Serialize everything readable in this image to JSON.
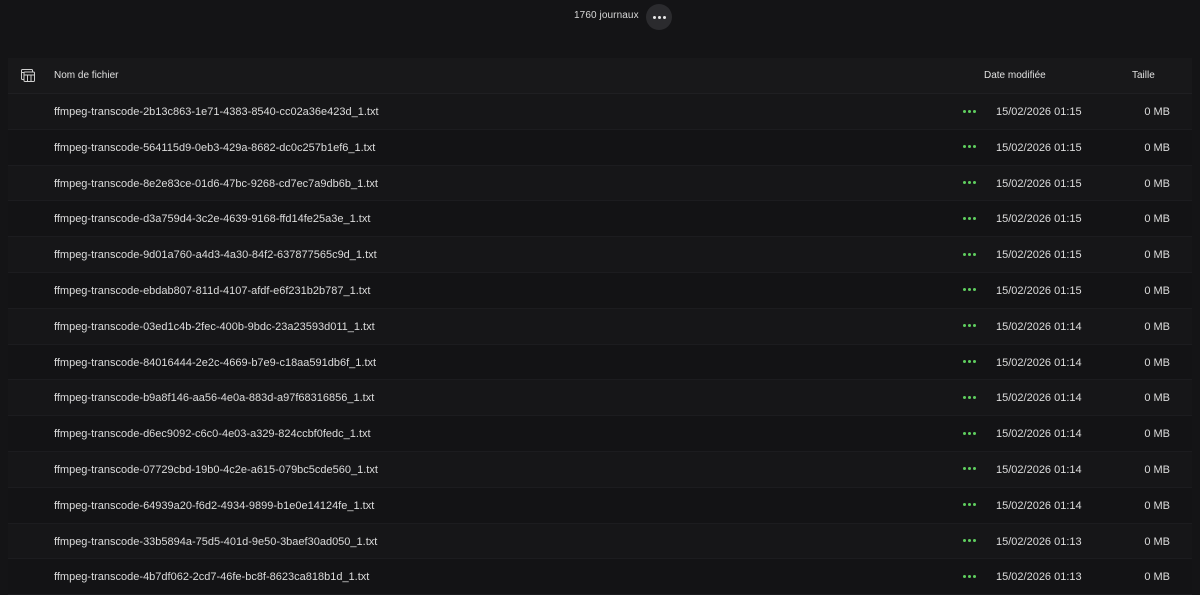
{
  "header": {
    "count_label": "1760 journaux",
    "more_icon": "more-horizontal-icon"
  },
  "table": {
    "columns": {
      "select_icon": "table-select-icon",
      "name": "Nom de fichier",
      "date": "Date modifiée",
      "size": "Taille"
    },
    "row_action_color": "#5fcf5f",
    "rows": [
      {
        "name": "ffmpeg-transcode-2b13c863-1e71-4383-8540-cc02a36e423d_1.txt",
        "date": "15/02/2026 01:15",
        "size": "0 MB"
      },
      {
        "name": "ffmpeg-transcode-564115d9-0eb3-429a-8682-dc0c257b1ef6_1.txt",
        "date": "15/02/2026 01:15",
        "size": "0 MB"
      },
      {
        "name": "ffmpeg-transcode-8e2e83ce-01d6-47bc-9268-cd7ec7a9db6b_1.txt",
        "date": "15/02/2026 01:15",
        "size": "0 MB"
      },
      {
        "name": "ffmpeg-transcode-d3a759d4-3c2e-4639-9168-ffd14fe25a3e_1.txt",
        "date": "15/02/2026 01:15",
        "size": "0 MB"
      },
      {
        "name": "ffmpeg-transcode-9d01a760-a4d3-4a30-84f2-637877565c9d_1.txt",
        "date": "15/02/2026 01:15",
        "size": "0 MB"
      },
      {
        "name": "ffmpeg-transcode-ebdab807-811d-4107-afdf-e6f231b2b787_1.txt",
        "date": "15/02/2026 01:15",
        "size": "0 MB"
      },
      {
        "name": "ffmpeg-transcode-03ed1c4b-2fec-400b-9bdc-23a23593d011_1.txt",
        "date": "15/02/2026 01:14",
        "size": "0 MB"
      },
      {
        "name": "ffmpeg-transcode-84016444-2e2c-4669-b7e9-c18aa591db6f_1.txt",
        "date": "15/02/2026 01:14",
        "size": "0 MB"
      },
      {
        "name": "ffmpeg-transcode-b9a8f146-aa56-4e0a-883d-a97f68316856_1.txt",
        "date": "15/02/2026 01:14",
        "size": "0 MB"
      },
      {
        "name": "ffmpeg-transcode-d6ec9092-c6c0-4e03-a329-824ccbf0fedc_1.txt",
        "date": "15/02/2026 01:14",
        "size": "0 MB"
      },
      {
        "name": "ffmpeg-transcode-07729cbd-19b0-4c2e-a615-079bc5cde560_1.txt",
        "date": "15/02/2026 01:14",
        "size": "0 MB"
      },
      {
        "name": "ffmpeg-transcode-64939a20-f6d2-4934-9899-b1e0e14124fe_1.txt",
        "date": "15/02/2026 01:14",
        "size": "0 MB"
      },
      {
        "name": "ffmpeg-transcode-33b5894a-75d5-401d-9e50-3baef30ad050_1.txt",
        "date": "15/02/2026 01:13",
        "size": "0 MB"
      },
      {
        "name": "ffmpeg-transcode-4b7df062-2cd7-46fe-bc8f-8623ca818b1d_1.txt",
        "date": "15/02/2026 01:13",
        "size": "0 MB"
      }
    ]
  }
}
